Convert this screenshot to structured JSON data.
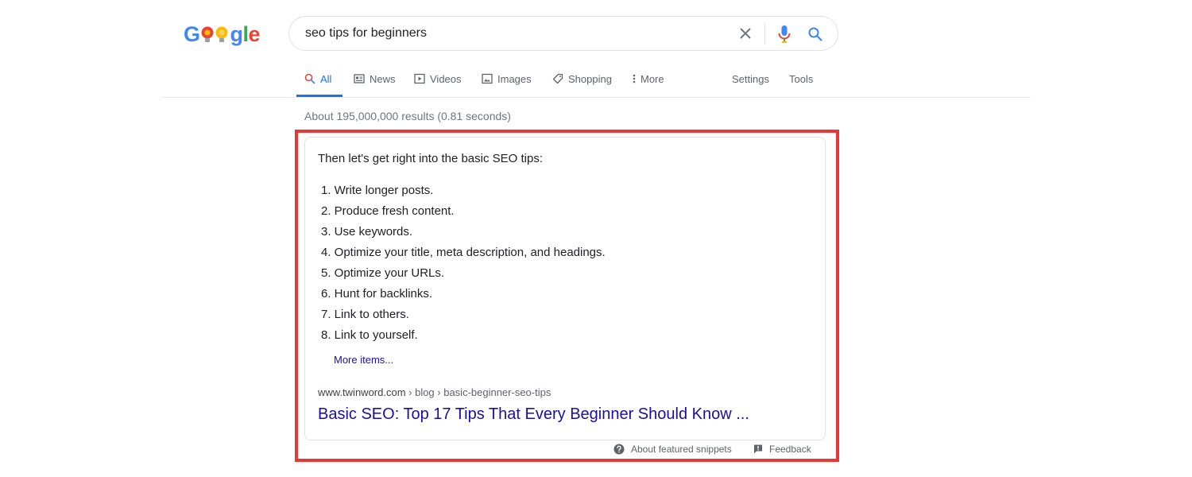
{
  "logo": {
    "letters": [
      "G",
      "g",
      "l",
      "e"
    ]
  },
  "search": {
    "query": "seo tips for beginners",
    "placeholder": ""
  },
  "tabs": [
    {
      "label": "All",
      "icon": "search-icon",
      "active": true
    },
    {
      "label": "News",
      "icon": "news-icon"
    },
    {
      "label": "Videos",
      "icon": "video-icon"
    },
    {
      "label": "Images",
      "icon": "image-icon"
    },
    {
      "label": "Shopping",
      "icon": "tag-icon"
    },
    {
      "label": "More",
      "icon": "more-vert-icon"
    }
  ],
  "tools": {
    "settings_label": "Settings",
    "tools_label": "Tools"
  },
  "results": {
    "stats": "About 195,000,000 results (0.81 seconds)"
  },
  "snippet": {
    "heading": "Then let's get right into the basic SEO tips:",
    "items": [
      "1. Write longer posts.",
      "2. Produce fresh content.",
      "3. Use keywords.",
      "4. Optimize your title, meta description, and headings.",
      "5. Optimize your URLs.",
      "6. Hunt for backlinks.",
      "7. Link to others.",
      "8. Link to yourself."
    ],
    "more_items": "More items...",
    "cite_domain": "www.twinword.com",
    "cite_path": " › blog › basic-beginner-seo-tips",
    "title": "Basic SEO: Top 17 Tips That Every Beginner Should Know ..."
  },
  "footer": {
    "about": "About featured snippets",
    "feedback": "Feedback"
  },
  "colors": {
    "accent_blue": "#1a73e8",
    "link_blue": "#1a0dab",
    "highlight_red": "#e53935",
    "logo_blue": "#4285f4",
    "logo_red": "#ea4335",
    "logo_yellow": "#fbbc05",
    "logo_green": "#34a853"
  }
}
